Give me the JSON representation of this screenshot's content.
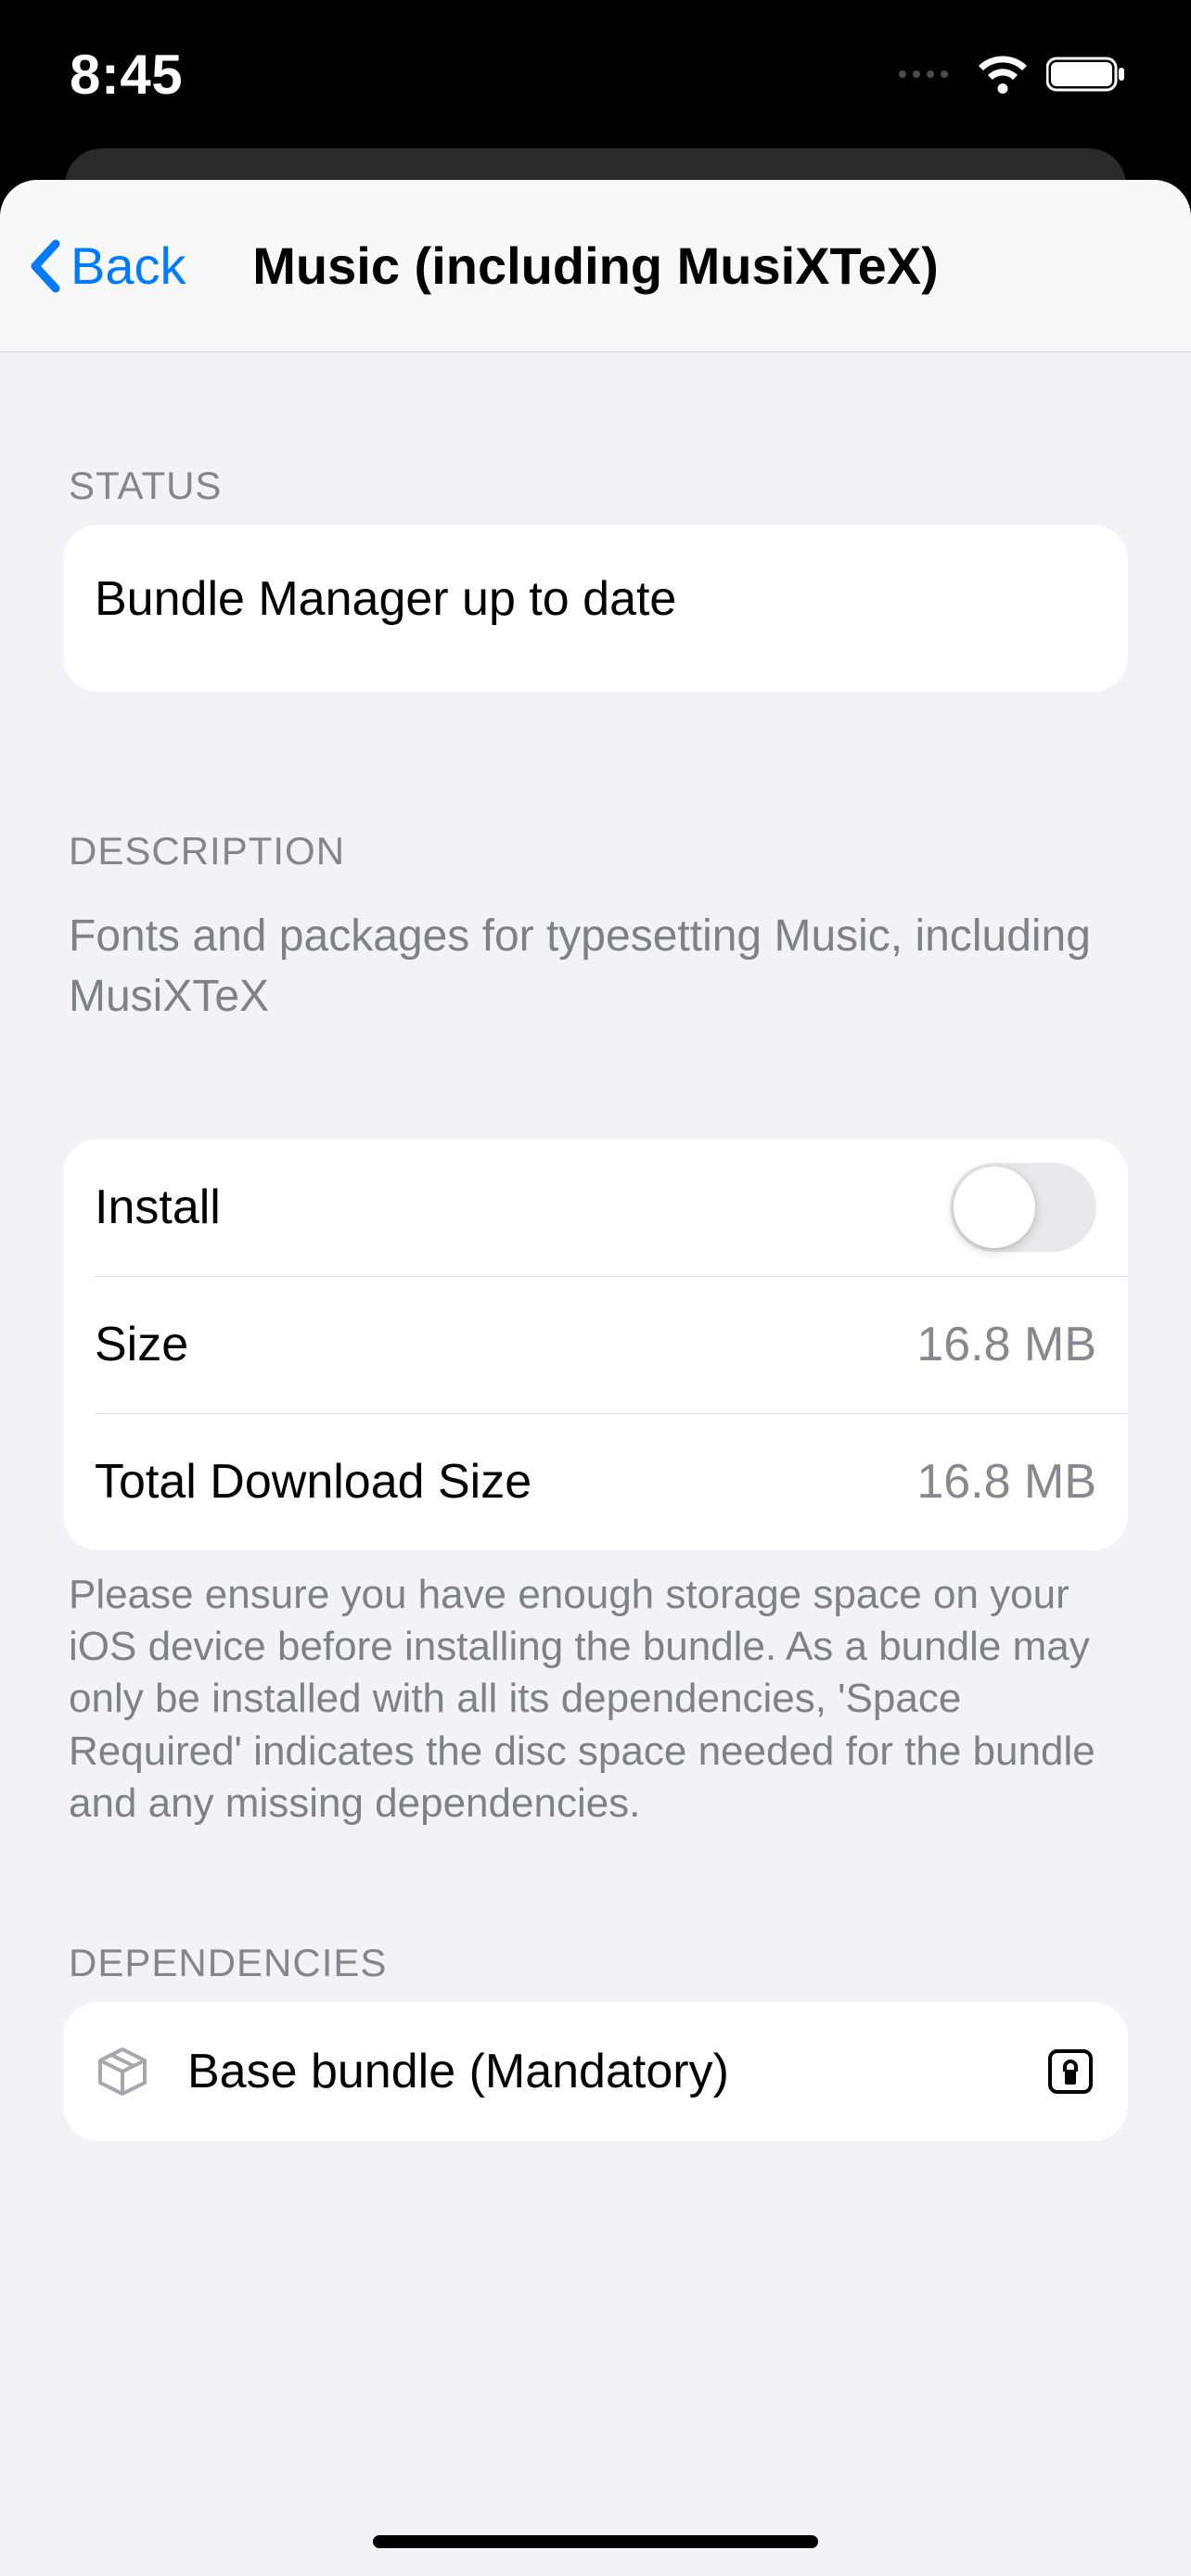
{
  "statusbar": {
    "time": "8:45"
  },
  "nav": {
    "back": "Back",
    "title": "Music (including MusiXTeX)"
  },
  "sections": {
    "status": {
      "header": "STATUS",
      "message": "Bundle Manager up to date"
    },
    "description": {
      "header": "DESCRIPTION",
      "text": "Fonts and packages for typesetting Music, including MusiXTeX"
    },
    "install": {
      "install_label": "Install",
      "size_label": "Size",
      "size_value": "16.8 MB",
      "total_label": "Total Download Size",
      "total_value": "16.8 MB",
      "footer": "Please ensure you have enough storage space on your iOS device before installing the bundle. As a bundle may only be installed with all its dependencies, 'Space Required' indicates the disc space needed for the bundle and any missing dependencies."
    },
    "dependencies": {
      "header": "DEPENDENCIES",
      "items": [
        {
          "label": "Base bundle (Mandatory)"
        }
      ]
    }
  }
}
